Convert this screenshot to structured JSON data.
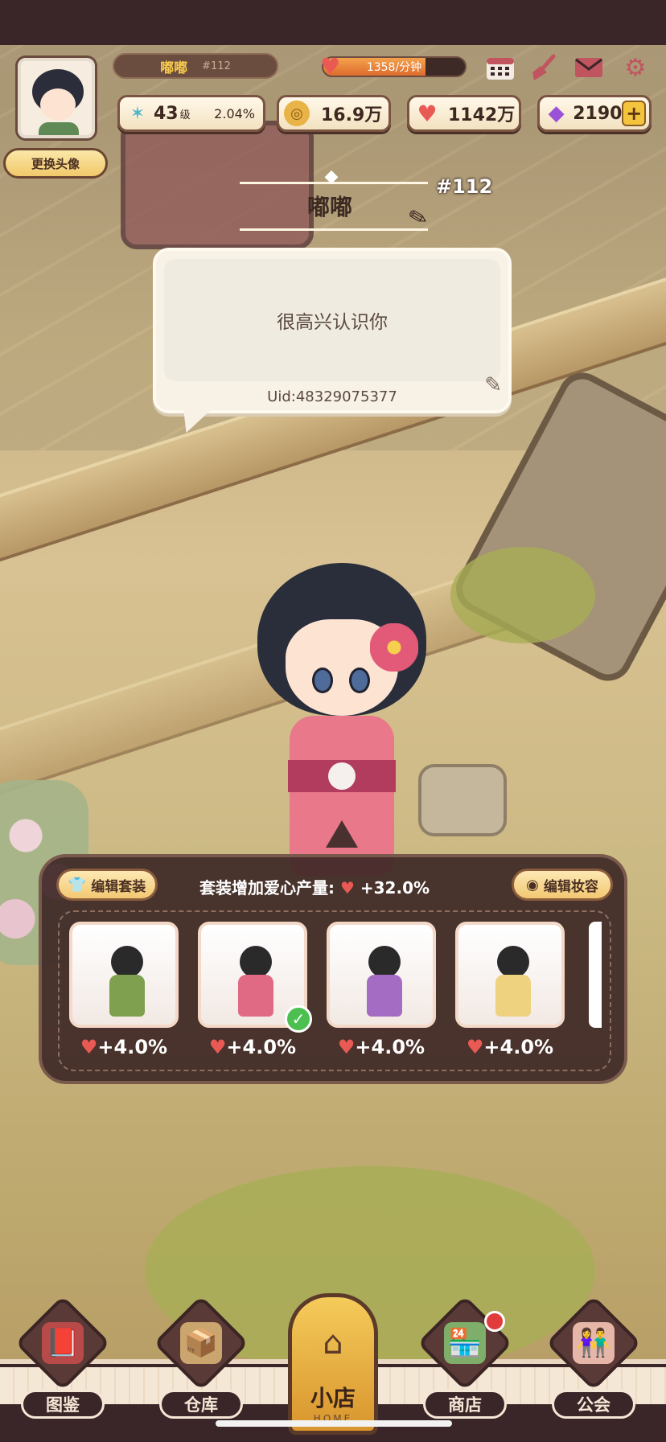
{
  "player": {
    "name": "嘟嘟",
    "number": "#112",
    "change_avatar_label": "更换头像",
    "uid": "Uid:48329075377",
    "greeting": "很高兴认识你"
  },
  "production": {
    "rate_text": "1358/分钟",
    "fill_percent": 72
  },
  "stats": {
    "level_value": "43",
    "level_unit": "级",
    "level_progress": "2.04%",
    "coins": "16.9万",
    "hearts": "1142万",
    "gems": "2190"
  },
  "outfit": {
    "edit_outfit_label": "编辑套装",
    "edit_makeup_label": "编辑妆容",
    "bonus_label": "套装增加爱心产量:",
    "bonus_value": "+32.0%",
    "slots": [
      {
        "bonus": "+4.0%",
        "color": "#7fa04f",
        "selected": false
      },
      {
        "bonus": "+4.0%",
        "color": "#e06a83",
        "selected": true
      },
      {
        "bonus": "+4.0%",
        "color": "#a46cc2",
        "selected": false
      },
      {
        "bonus": "+4.0%",
        "color": "#eed27f",
        "selected": false
      }
    ]
  },
  "nav": {
    "catalog": "图鉴",
    "storage": "仓库",
    "home": "小店",
    "home_sub": "HOME",
    "shop": "商店",
    "guild": "公会"
  },
  "colors": {
    "accent_gold": "#f6c84c",
    "heart_red": "#ea5a55",
    "panel_brown": "#3e2826"
  },
  "icons": {
    "calendar": "calendar-icon",
    "broom": "broom-icon",
    "mail": "mail-icon",
    "settings": "gear-icon"
  }
}
